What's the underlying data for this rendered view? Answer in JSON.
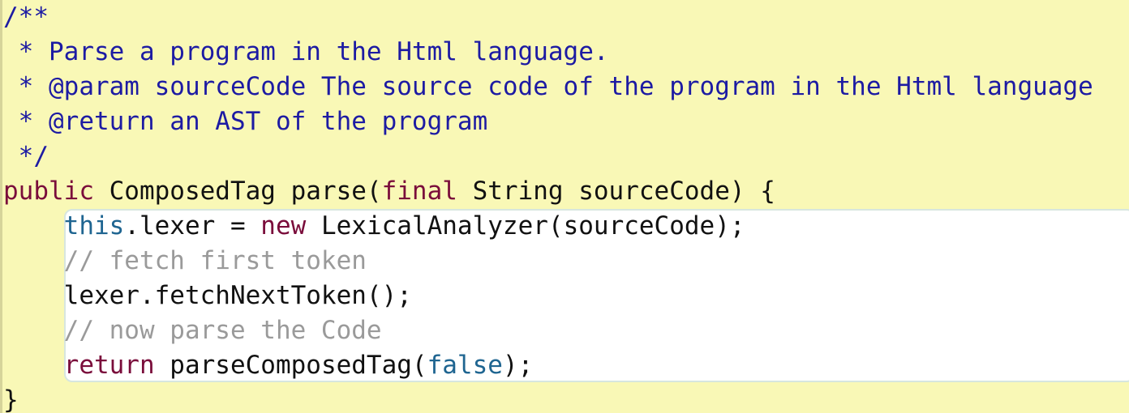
{
  "code": {
    "doc_open": "/**",
    "doc_line1": " * Parse a program in the Html language.",
    "doc_line2": " * @param sourceCode The source code of the program in the Html language",
    "doc_line3": " * @return an AST of the program",
    "doc_close": " */",
    "sig_kw_public": "public",
    "sig_rest1": " ComposedTag parse(",
    "sig_kw_final": "final",
    "sig_rest2": " String sourceCode) {",
    "body_indent": "    ",
    "this_kw": "this",
    "lexer_assign": ".lexer = ",
    "new_kw": "new",
    "lexer_ctor": " LexicalAnalyzer(sourceCode);",
    "comment_fetch": "// fetch first token",
    "fetch_call": "lexer.fetchNextToken();",
    "comment_parse": "// now parse the Code",
    "return_kw": "return",
    "return_call": " parseComposedTag(",
    "false_lit": "false",
    "return_end": ");",
    "closing_brace": "}"
  },
  "colors": {
    "background": "#f9f8b6",
    "inner_block": "#ffffff",
    "javadoc": "#1d1ba3",
    "keyword": "#7a0d3b",
    "literal": "#1f6591",
    "comment": "#9a9a9a",
    "text": "#111111"
  }
}
